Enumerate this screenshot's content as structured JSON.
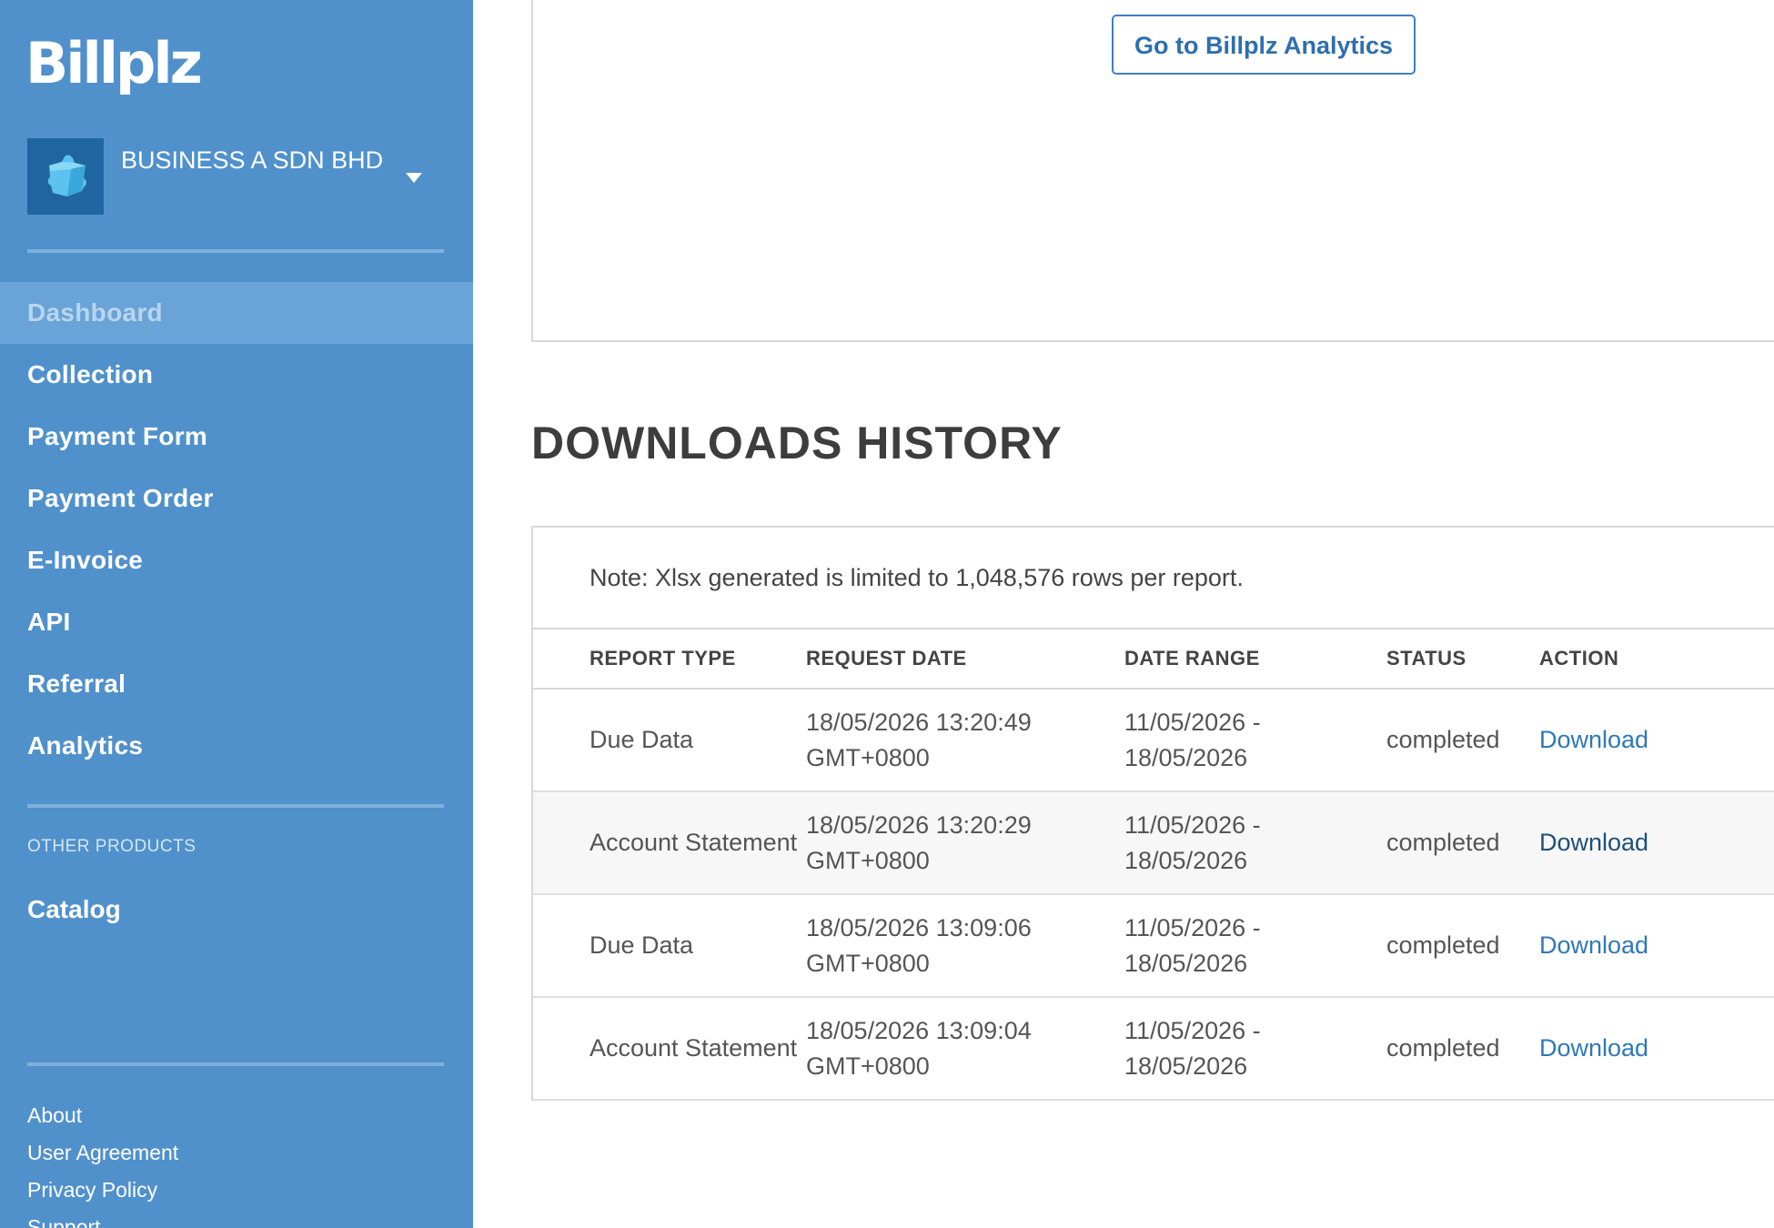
{
  "sidebar": {
    "logo": "Billplz",
    "business_name": "BUSINESS A SDN BHD",
    "nav": [
      {
        "label": "Dashboard",
        "active": true
      },
      {
        "label": "Collection"
      },
      {
        "label": "Payment Form"
      },
      {
        "label": "Payment Order"
      },
      {
        "label": "E-Invoice"
      },
      {
        "label": "API"
      },
      {
        "label": "Referral"
      },
      {
        "label": "Analytics"
      }
    ],
    "other_products_label": "OTHER PRODUCTS",
    "catalog": "Catalog",
    "footer_links": [
      "About",
      "User Agreement",
      "Privacy Policy",
      "Support"
    ]
  },
  "main": {
    "analytics_button": "Go to Billplz Analytics",
    "section_title": "DOWNLOADS HISTORY",
    "note": "Note: Xlsx generated is limited to 1,048,576 rows per report.",
    "columns": [
      "REPORT TYPE",
      "REQUEST DATE",
      "DATE RANGE",
      "STATUS",
      "ACTION"
    ],
    "rows": [
      {
        "report_type": "Due Data",
        "request_date": "18/05/2026 13:20:49 GMT+0800",
        "date_range": "11/05/2026 - 18/05/2026",
        "status": "completed",
        "action": "Download"
      },
      {
        "report_type": "Account Statement",
        "request_date": "18/05/2026 13:20:29 GMT+0800",
        "date_range": "11/05/2026 - 18/05/2026",
        "status": "completed",
        "action": "Download"
      },
      {
        "report_type": "Due Data",
        "request_date": "18/05/2026 13:09:06 GMT+0800",
        "date_range": "11/05/2026 - 18/05/2026",
        "status": "completed",
        "action": "Download"
      },
      {
        "report_type": "Account Statement",
        "request_date": "18/05/2026 13:09:04 GMT+0800",
        "date_range": "11/05/2026 - 18/05/2026",
        "status": "completed",
        "action": "Download"
      }
    ]
  },
  "colors": {
    "sidebar_bg": "#5091cc",
    "sidebar_active": "#6aa3d7",
    "link": "#2f78b8",
    "heading": "#3d3d3d"
  },
  "icons": {
    "business_avatar": "puzzle-piece-icon",
    "business_menu": "caret-down-icon"
  }
}
